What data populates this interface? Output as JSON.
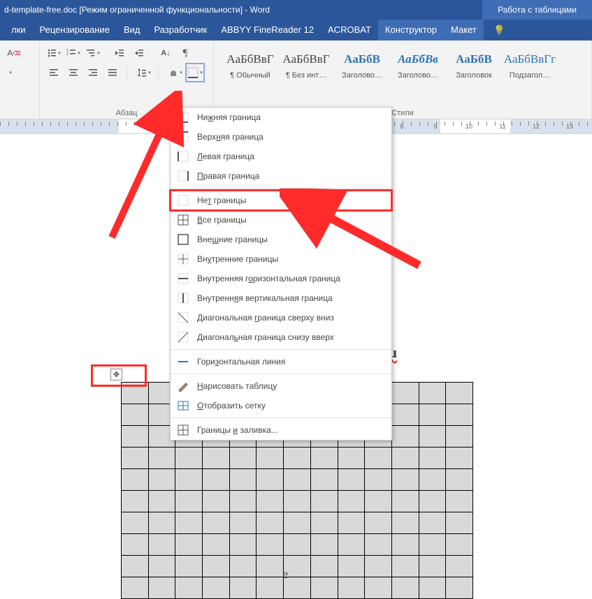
{
  "title": {
    "filename": "d-template-free.doc",
    "mode": "[Режим ограниченной функциональности]",
    "app": "Word",
    "table_tools": "Работа с таблицами"
  },
  "tabs": {
    "t0": "лки",
    "t1": "Рецензирование",
    "t2": "Вид",
    "t3": "Разработчик",
    "t4": "ABBYY FineReader 12",
    "t5": "ACROBAT",
    "t6": "Конструктор",
    "t7": "Макет"
  },
  "para_group": "Абзац",
  "styles_group": "Стили",
  "styles": [
    {
      "prev": "АаБбВвГ",
      "name": "¶ Обычный",
      "bold": false,
      "ital": false
    },
    {
      "prev": "АаБбВвГ",
      "name": "¶ Без инт…",
      "bold": false,
      "ital": false
    },
    {
      "prev": "АаБбВ",
      "name": "Заголово…",
      "bold": true,
      "ital": false
    },
    {
      "prev": "АаБбВв",
      "name": "Заголово…",
      "bold": true,
      "ital": true
    },
    {
      "prev": "АаБбВ",
      "name": "Заголовок",
      "bold": true,
      "ital": false
    },
    {
      "prev": "АаБбВвГг",
      "name": "Подзагол…",
      "bold": false,
      "ital": false
    }
  ],
  "dropdown": [
    {
      "k": "bottom",
      "label_pre": "Ни",
      "acc": "ж",
      "label_post": "няя граница"
    },
    {
      "k": "top",
      "label_pre": "Верх",
      "acc": "н",
      "label_post": "яя граница"
    },
    {
      "k": "left",
      "label_pre": "",
      "acc": "Л",
      "label_post": "евая граница"
    },
    {
      "k": "right",
      "label_pre": "",
      "acc": "П",
      "label_post": "равая граница"
    },
    {
      "k": "none",
      "label_pre": "Не",
      "acc": "т",
      "label_post": " границы",
      "hl": true
    },
    {
      "k": "all",
      "label_pre": "",
      "acc": "В",
      "label_post": "се границы"
    },
    {
      "k": "outer",
      "label_pre": "Вне",
      "acc": "ш",
      "label_post": "ние границы"
    },
    {
      "k": "inner",
      "label_pre": "Вн",
      "acc": "у",
      "label_post": "тренние границы"
    },
    {
      "k": "ih",
      "label_pre": "Внутренняя г",
      "acc": "о",
      "label_post": "ризонтальная граница"
    },
    {
      "k": "iv",
      "label_pre": "Внутренн",
      "acc": "я",
      "label_post": "я вертикальная граница"
    },
    {
      "k": "ddown",
      "label_pre": "Диагональная ",
      "acc": "г",
      "label_post": "раница сверху вниз"
    },
    {
      "k": "dup",
      "label_pre": "Диагонал",
      "acc": "ь",
      "label_post": "ная граница снизу вверх"
    },
    {
      "k": "hline",
      "label_pre": "Гори",
      "acc": "з",
      "label_post": "онтальная линия"
    },
    {
      "k": "draw",
      "label_pre": "",
      "acc": "Н",
      "label_post": "арисовать таблицу"
    },
    {
      "k": "grid",
      "label_pre": "",
      "acc": "О",
      "label_post": "тобразить сетку"
    },
    {
      "k": "dlg",
      "label_pre": "Границы ",
      "acc": "и",
      "label_post": " заливка..."
    }
  ],
  "ruler_nums": [
    "8",
    "9",
    "10",
    "11",
    "12",
    "13"
  ],
  "doc": {
    "ru": "Ru",
    "e": "e"
  }
}
